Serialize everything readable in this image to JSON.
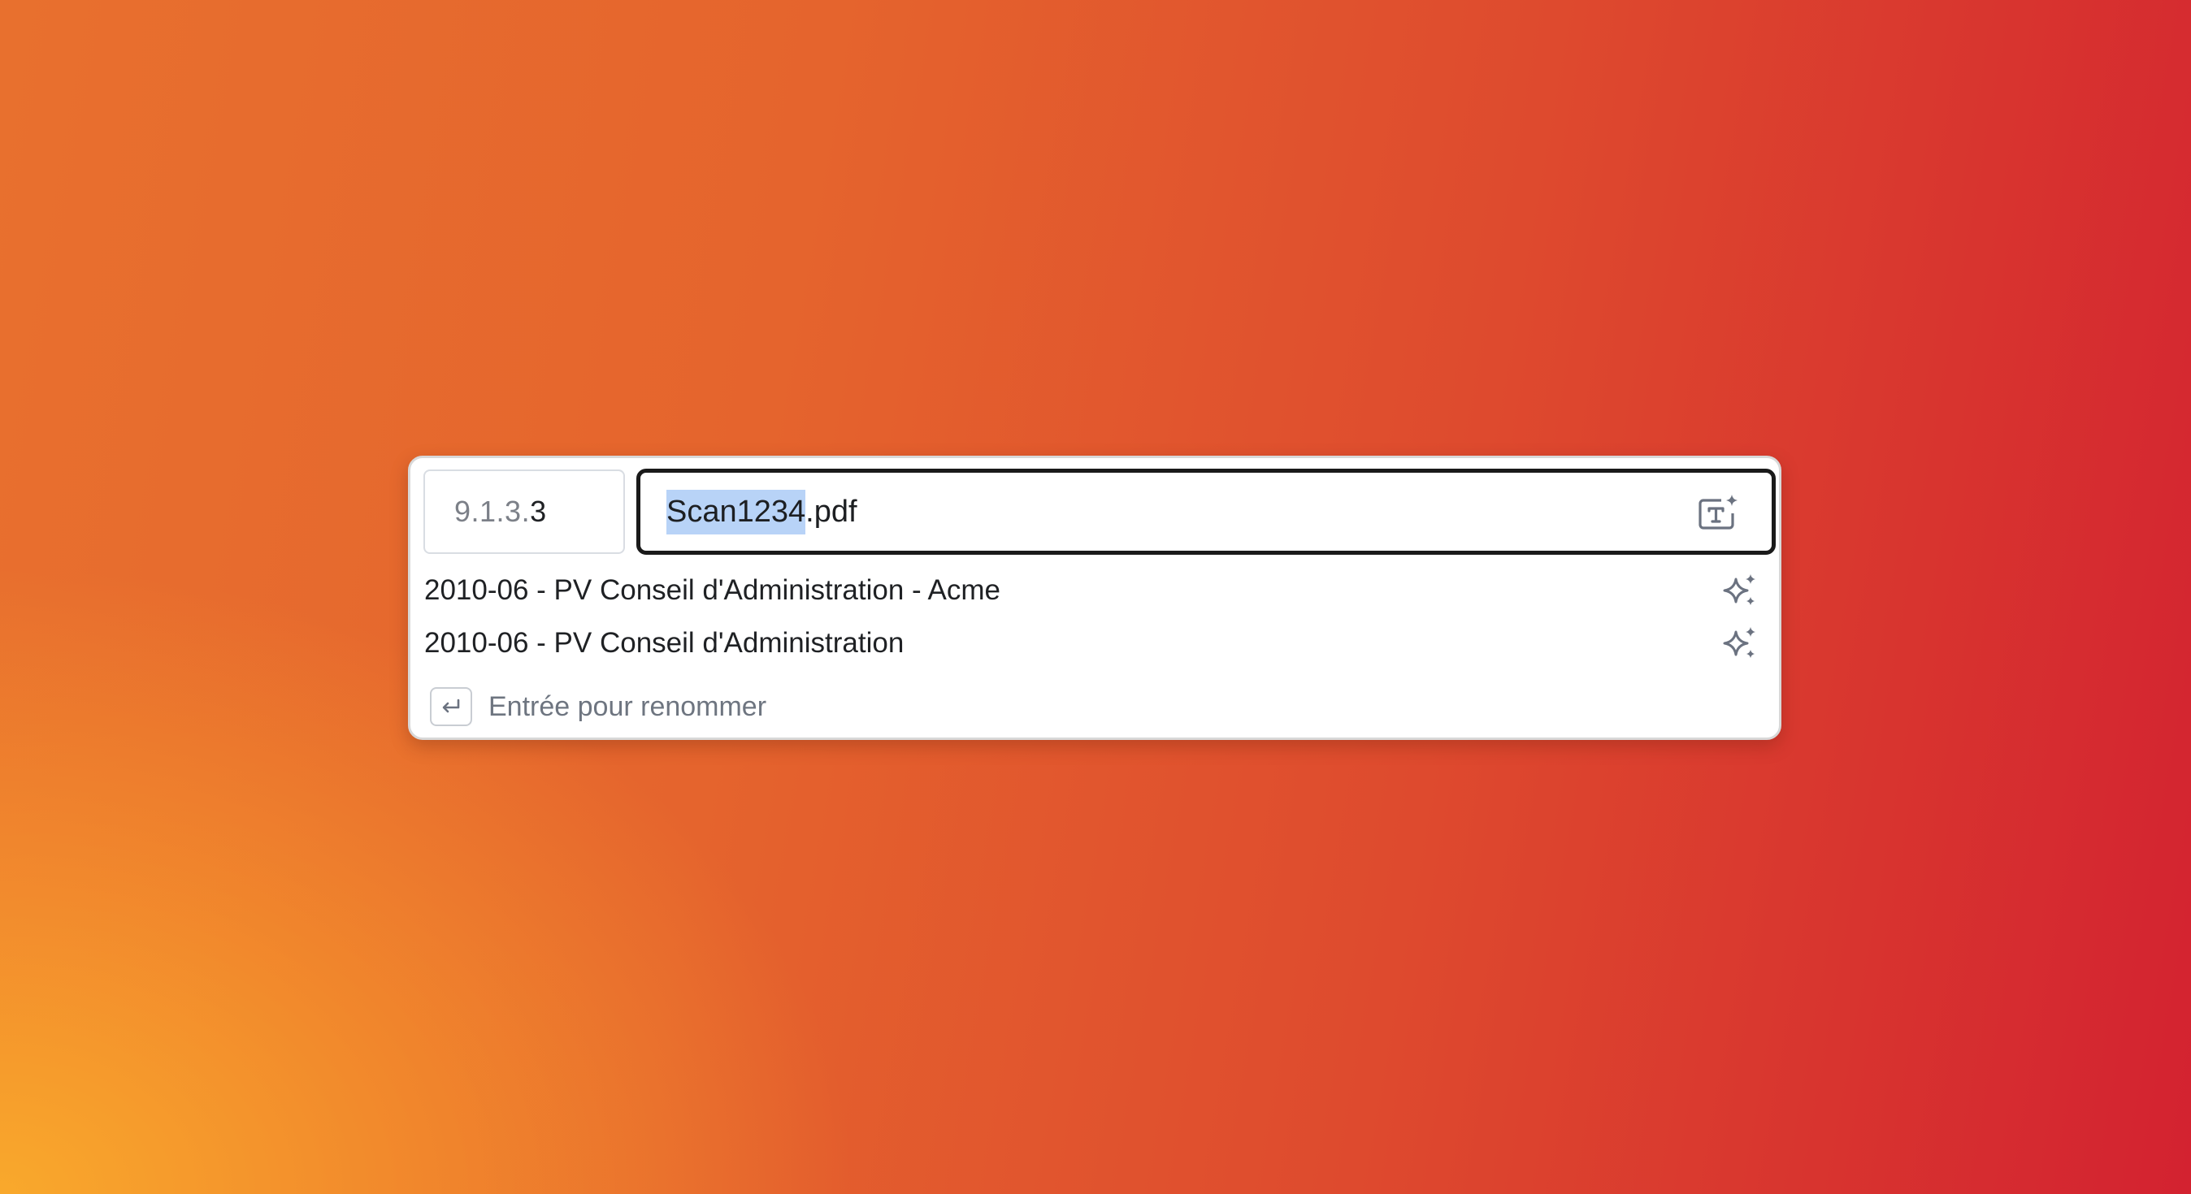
{
  "colors": {
    "background_gradient": [
      "#fbad2b",
      "#e8702e",
      "#d32230"
    ],
    "selection_highlight": "#b8d3f7",
    "field_border": "#1a1a1a",
    "icon_gray": "#6b7280"
  },
  "rename_bar": {
    "index": {
      "prefix": "9.1.3.",
      "last": "3"
    },
    "filename": {
      "selected_part": "Scan1234",
      "extension": ".pdf"
    },
    "ai_rename_icon": "text-sparkle-icon"
  },
  "suggestions": [
    {
      "label": "2010-06 - PV Conseil d'Administration - Acme",
      "icon": "sparkles-icon"
    },
    {
      "label": "2010-06 - PV Conseil d'Administration",
      "icon": "sparkles-icon"
    }
  ],
  "hint": {
    "key_icon": "return-key-icon",
    "text": "Entrée pour renommer"
  }
}
